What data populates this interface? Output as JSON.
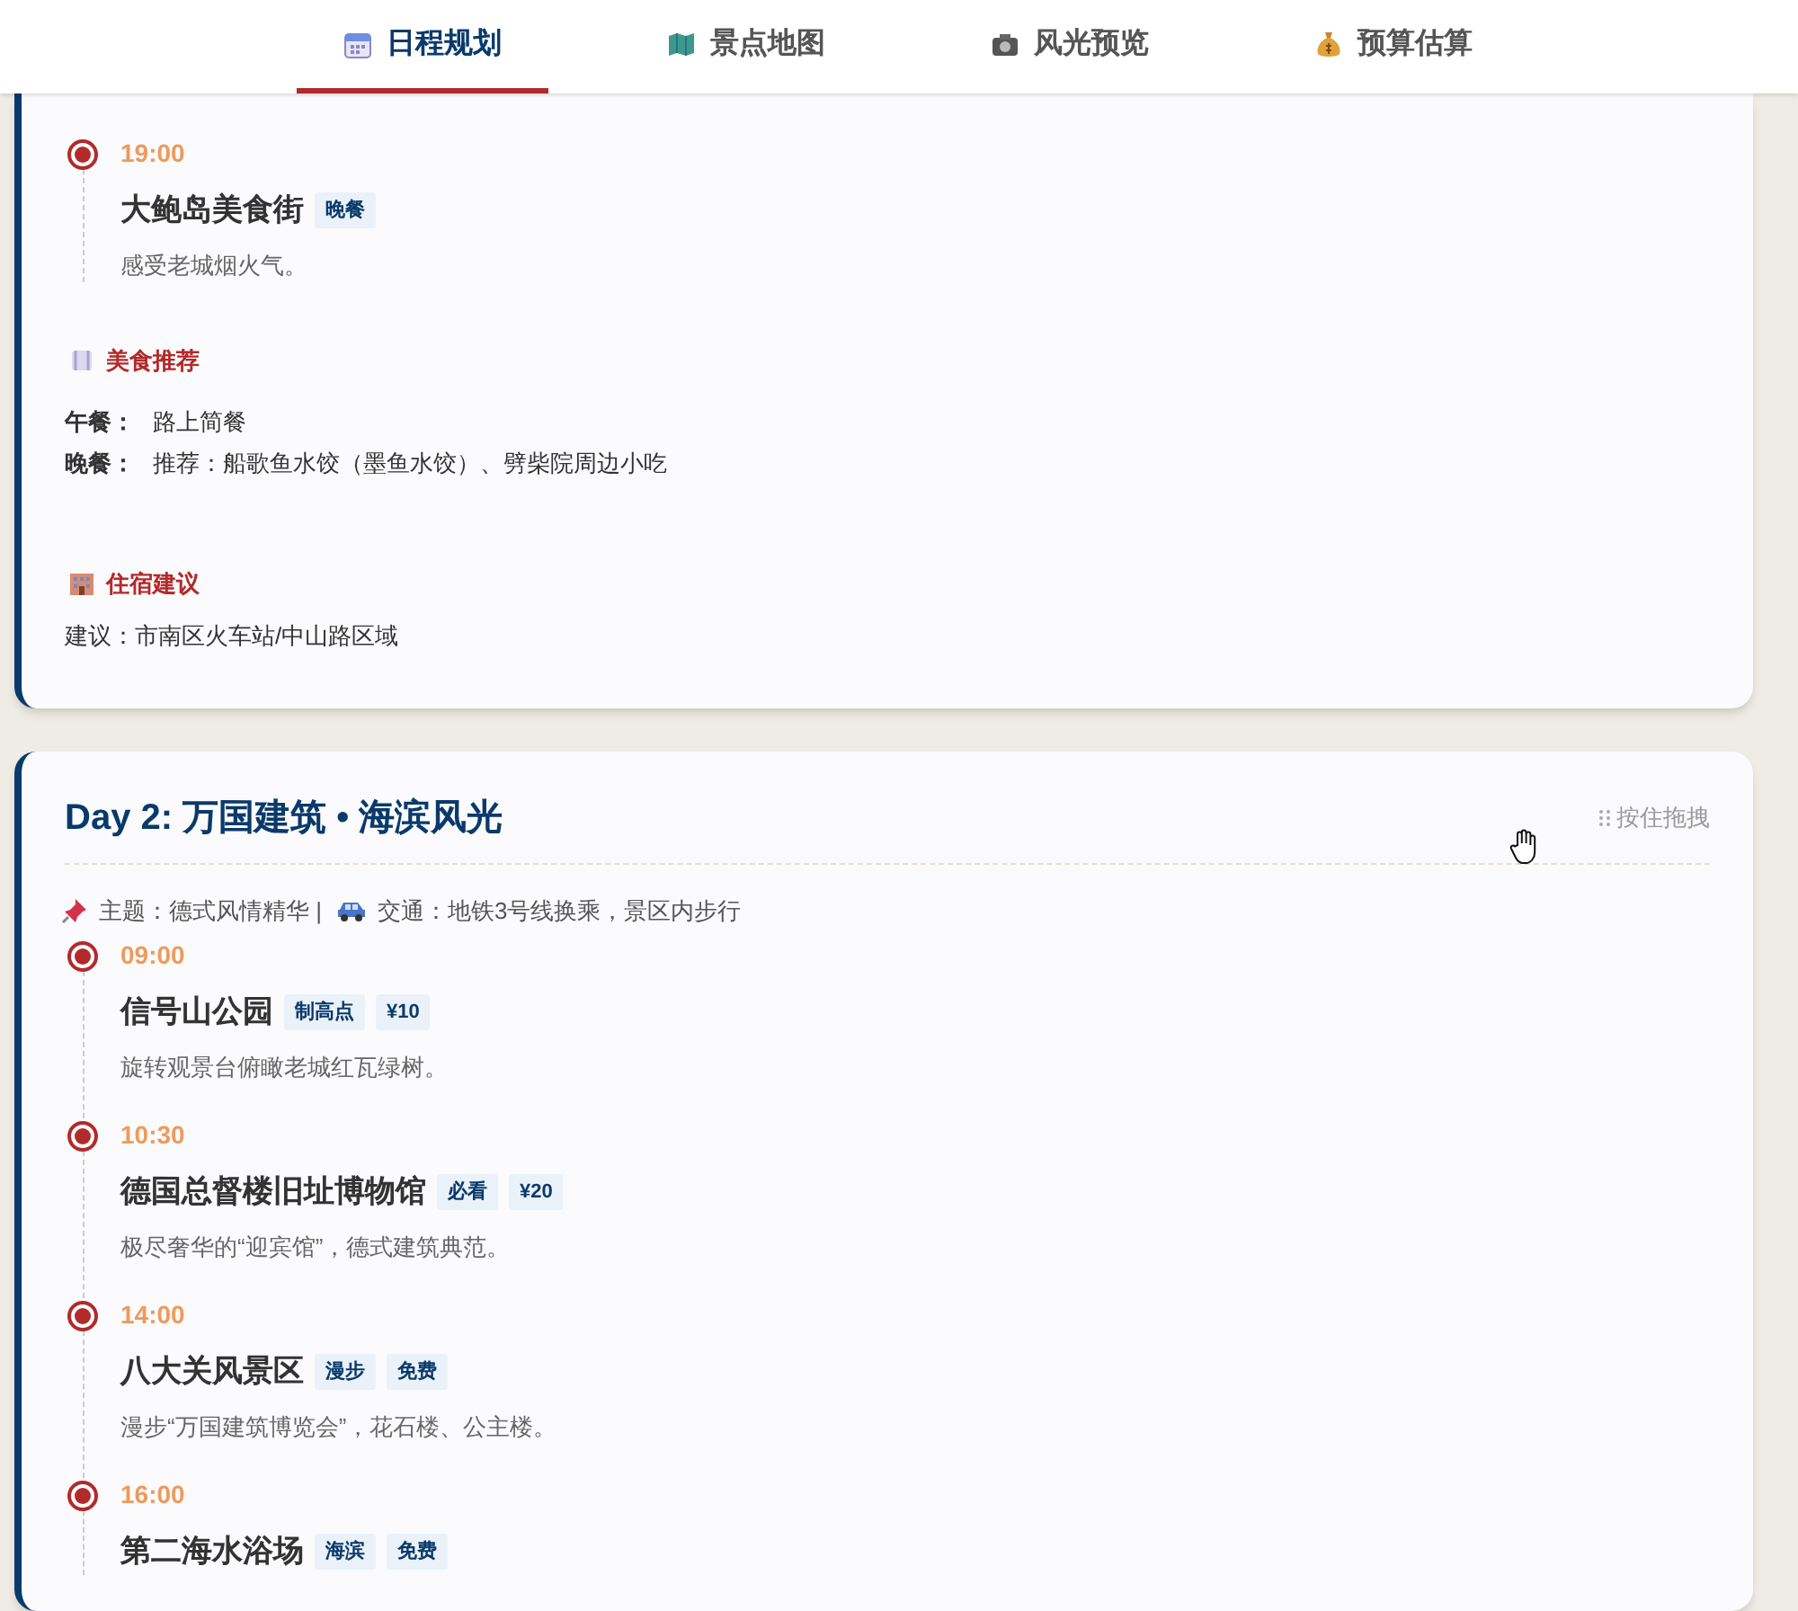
{
  "tabs": [
    {
      "label": "日程规划",
      "selected": true
    },
    {
      "label": "景点地图",
      "selected": false
    },
    {
      "label": "风光预览",
      "selected": false
    },
    {
      "label": "预算估算",
      "selected": false
    }
  ],
  "days": [
    {
      "schedule": [
        {
          "time": "19:00",
          "name": "大鲍岛美食街",
          "tags": [
            "晚餐"
          ],
          "desc": "感受老城烟火气。"
        }
      ],
      "food": {
        "heading": "美食推荐",
        "rows": [
          {
            "label": "午餐：",
            "value": "路上简餐"
          },
          {
            "label": "晚餐：",
            "value": "推荐：船歌鱼水饺（墨鱼水饺）、劈柴院周边小吃"
          }
        ]
      },
      "lodging": {
        "heading": "住宿建议",
        "text": "建议：市南区火车站/中山路区域"
      }
    },
    {
      "title": "Day 2: 万国建筑 • 海滨风光",
      "drag_hint": "按住拖拽",
      "meta": [
        {
          "kind": "theme",
          "text": "主题：德式风情精华 |"
        },
        {
          "kind": "transport",
          "text": "交通：地铁3号线换乘，景区内步行"
        }
      ],
      "schedule": [
        {
          "time": "09:00",
          "name": "信号山公园",
          "tags": [
            "制高点",
            "¥10"
          ],
          "desc": "旋转观景台俯瞰老城红瓦绿树。"
        },
        {
          "time": "10:30",
          "name": "德国总督楼旧址博物馆",
          "tags": [
            "必看",
            "¥20"
          ],
          "desc": "极尽奢华的“迎宾馆”，德式建筑典范。"
        },
        {
          "time": "14:00",
          "name": "八大关风景区",
          "tags": [
            "漫步",
            "免费"
          ],
          "desc": "漫步“万国建筑博览会”，花石楼、公主楼。"
        },
        {
          "time": "16:00",
          "name": "第二海水浴场",
          "tags": [
            "海滨",
            "免费"
          ]
        }
      ]
    }
  ]
}
